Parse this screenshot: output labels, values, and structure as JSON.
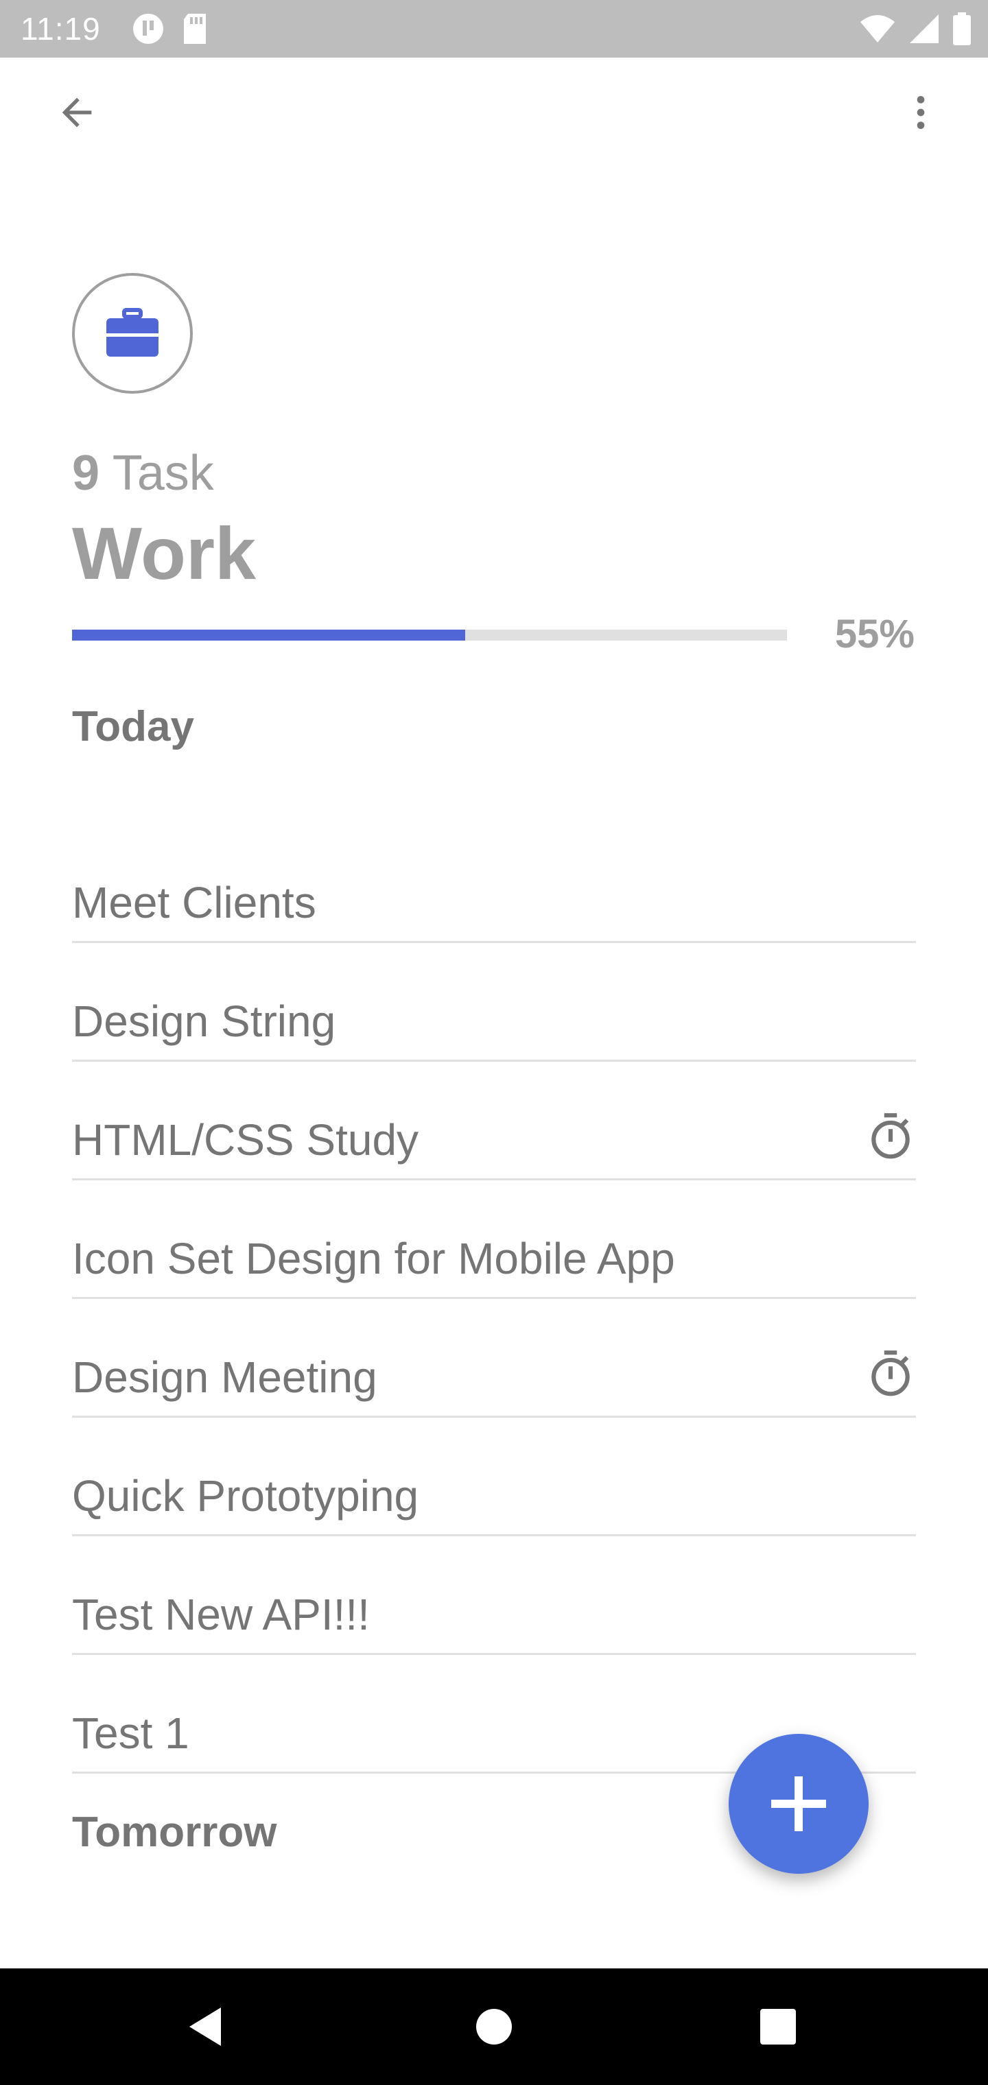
{
  "status_bar": {
    "time": "11:19"
  },
  "category": {
    "task_count": "9",
    "task_word": "Task",
    "title": "Work",
    "progress_percent": 55,
    "progress_label": "55%"
  },
  "sections": {
    "today": "Today",
    "tomorrow": "Tomorrow"
  },
  "tasks": [
    {
      "label": "Meet Clients",
      "has_timer": false
    },
    {
      "label": "Design String",
      "has_timer": false
    },
    {
      "label": "HTML/CSS Study",
      "has_timer": true
    },
    {
      "label": "Icon Set Design for Mobile App",
      "has_timer": false
    },
    {
      "label": "Design Meeting",
      "has_timer": true
    },
    {
      "label": "Quick Prototyping",
      "has_timer": false
    },
    {
      "label": "Test New API!!!",
      "has_timer": false
    },
    {
      "label": "Test 1",
      "has_timer": false
    }
  ],
  "icons": {
    "back": "arrow-back-icon",
    "more": "more-vert-icon",
    "category": "briefcase-icon",
    "timer": "timer-icon",
    "add": "plus-icon"
  },
  "colors": {
    "accent": "#5065d6",
    "fab": "#4f74e0",
    "text_muted": "#9e9e9e",
    "text": "#757575",
    "divider": "#e0e0e0"
  }
}
